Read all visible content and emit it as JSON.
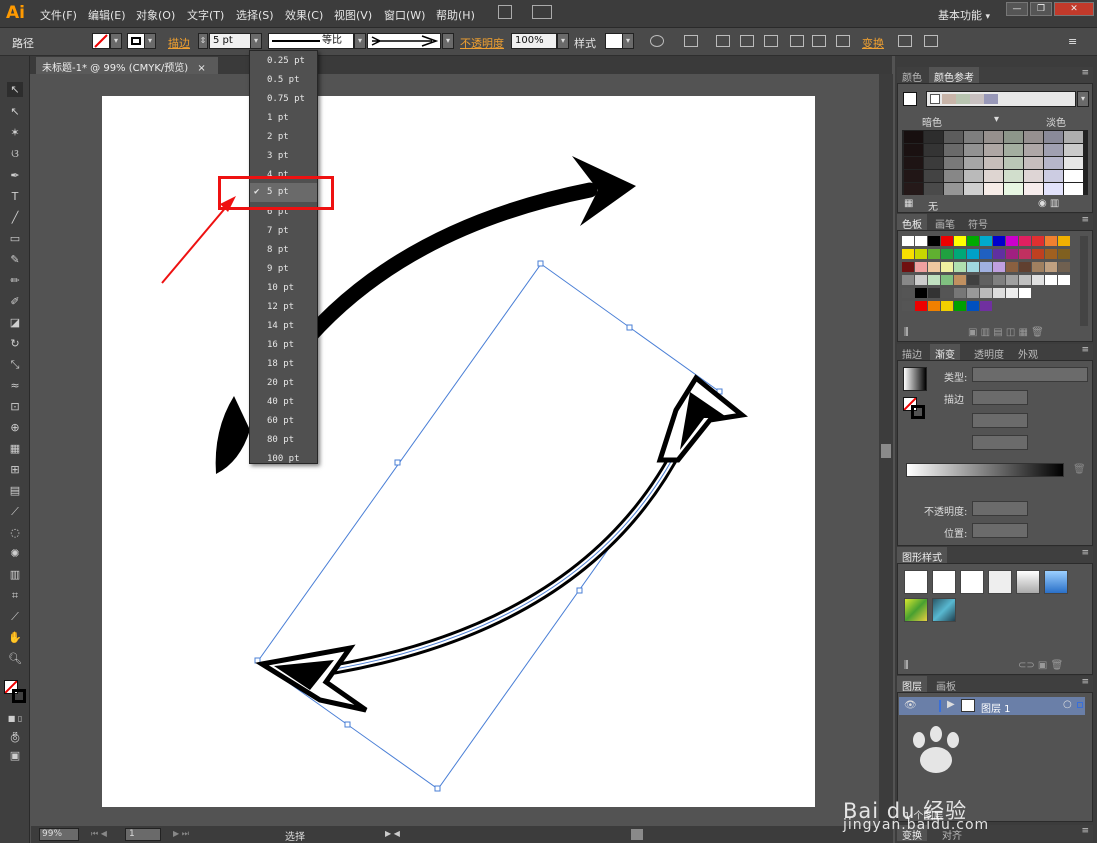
{
  "app": {
    "logo": "Ai",
    "workspace": "基本功能",
    "workspace_arrow": "▾"
  },
  "menu": [
    "文件(F)",
    "编辑(E)",
    "对象(O)",
    "文字(T)",
    "选择(S)",
    "效果(C)",
    "视图(V)",
    "窗口(W)",
    "帮助(H)"
  ],
  "window_buttons": [
    "—",
    "❐",
    "✕"
  ],
  "control": {
    "object_type": "路径",
    "stroke_label": "描边",
    "stroke_value": "5 pt",
    "profile_label": "等比",
    "opacity_label": "不透明度",
    "opacity_value": "100%",
    "style_label": "样式",
    "transform_label": "变换"
  },
  "document": {
    "tab_title": "未标题-1* @ 99% (CMYK/预览)",
    "tab_close": "×"
  },
  "stroke_dropdown": {
    "items": [
      "0.25 pt",
      "0.5 pt",
      "0.75 pt",
      "1 pt",
      "2 pt",
      "3 pt",
      "4 pt",
      "5 pt",
      "6 pt",
      "7 pt",
      "8 pt",
      "9 pt",
      "10 pt",
      "12 pt",
      "14 pt",
      "16 pt",
      "18 pt",
      "20 pt",
      "40 pt",
      "60 pt",
      "80 pt",
      "100 pt"
    ],
    "selected": "5 pt",
    "check": "✔"
  },
  "status": {
    "zoom": "99%",
    "page": "1",
    "mode": "选择"
  },
  "panels": {
    "color_tabs": [
      "颜色",
      "颜色参考"
    ],
    "color_guide_dark": "暗色",
    "color_guide_light": "淡色",
    "color_guide_none": "无",
    "swatch_tabs": [
      "色板",
      "画笔",
      "符号"
    ],
    "stroke_tabs": [
      "描边",
      "渐变",
      "透明度",
      "外观"
    ],
    "gradient_type_label": "类型:",
    "gradient_stroke_label": "描边",
    "gradient_opacity_label": "不透明度:",
    "gradient_position_label": "位置:",
    "graphic_styles_tab": "图形样式",
    "layers_tabs": [
      "图层",
      "画板"
    ],
    "layer_name": "图层 1",
    "layer_count": "1 个图层",
    "bottom_tabs": [
      "变换",
      "对齐"
    ]
  },
  "watermark": {
    "brand": "Bai du 经验",
    "url": "jingyan.baidu.com"
  },
  "colors": {
    "accent_orange": "#ff9a00",
    "annotation_red": "#ee1111",
    "selection_blue": "#4a7fd6"
  }
}
